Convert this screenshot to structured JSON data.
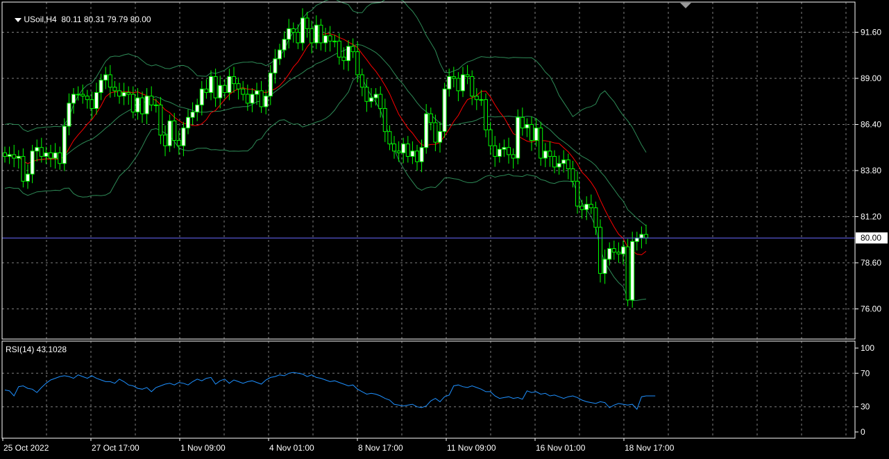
{
  "header": {
    "symbol": "USoil,H4",
    "ohlc": "80.11 80.31 79.79 80.00"
  },
  "rsi_panel": {
    "label": "RSI(14) 43.1028",
    "levels": [
      "100",
      "70",
      "30",
      "0"
    ]
  },
  "price_axis": {
    "ticks": [
      "91.60",
      "89.00",
      "86.40",
      "83.80",
      "81.20",
      "78.60",
      "76.00"
    ],
    "current_price": "80.00"
  },
  "time_axis": {
    "labels": [
      "25 Oct 2022",
      "27 Oct 17:00",
      "1 Nov 09:00",
      "4 Nov 01:00",
      "8 Nov 17:00",
      "11 Nov 09:00",
      "16 Nov 01:00",
      "18 Nov 17:00"
    ]
  },
  "colors": {
    "background": "#000000",
    "bull": "#ffffff",
    "bear": "#000000",
    "candle_outline": "#00ff00",
    "bands": "#2e8b57",
    "ma": "#ff0000",
    "rsi": "#1e90ff",
    "grid": "#808080",
    "price_line": "#6a6aff"
  },
  "chart_data": {
    "type": "candlestick",
    "title": "USoil,H4",
    "ylim": [
      74.3,
      93.3
    ],
    "current": 80.0,
    "closes": [
      84.6,
      84.7,
      84.5,
      84.6,
      83.2,
      83.6,
      84.9,
      85.1,
      84.6,
      84.8,
      84.5,
      84.8,
      84.2,
      86.3,
      87.6,
      88.1,
      88.1,
      88.0,
      87.8,
      87.3,
      88.2,
      88.9,
      89.2,
      88.5,
      88.3,
      88.0,
      88.2,
      88.1,
      87.1,
      87.9,
      87.0,
      88.0,
      87.5,
      87.5,
      85.8,
      85.2,
      86.6,
      85.5,
      85.2,
      86.2,
      86.8,
      87.1,
      87.5,
      88.4,
      88.2,
      89.1,
      87.9,
      88.6,
      88.2,
      89.1,
      88.7,
      88.4,
      88.1,
      87.6,
      88.1,
      88.3,
      87.4,
      88.0,
      89.3,
      90.1,
      90.6,
      91.2,
      91.8,
      91.6,
      91.0,
      92.4,
      91.8,
      91.0,
      92.0,
      91.0,
      91.4,
      91.1,
      91.1,
      90.2,
      90.0,
      90.8,
      90.5,
      89.2,
      88.5,
      87.7,
      87.9,
      88.1,
      87.3,
      86.0,
      85.3,
      84.9,
      84.8,
      85.3,
      84.6,
      84.9,
      84.3,
      85.1,
      87.0,
      86.5,
      85.4,
      86.0,
      88.4,
      89.1,
      89.0,
      88.3,
      89.2,
      89.1,
      88.0,
      87.8,
      87.8,
      86.1,
      85.2,
      84.6,
      85.0,
      85.1,
      84.7,
      84.5,
      86.8,
      86.2,
      86.4,
      85.5,
      86.2,
      84.5,
      84.9,
      84.6,
      84.0,
      84.2,
      84.4,
      83.9,
      83.2,
      81.8,
      81.6,
      81.9,
      81.7,
      80.6,
      78.0,
      78.8,
      79.4,
      79.2,
      79.1,
      79.5,
      76.5,
      79.8,
      80.0,
      80.2,
      80.0
    ],
    "rsi": [
      50,
      49,
      43,
      54,
      55,
      52,
      51,
      47,
      53,
      58,
      62,
      64,
      66,
      67,
      66,
      64,
      68,
      66,
      64,
      67,
      64,
      62,
      60,
      60,
      58,
      63,
      60,
      56,
      55,
      52,
      51,
      53,
      48,
      53,
      55,
      57,
      58,
      56,
      59,
      58,
      56,
      60,
      63,
      61,
      64,
      65,
      57,
      61,
      63,
      58,
      62,
      60,
      58,
      60,
      61,
      59,
      57,
      62,
      65,
      66,
      68,
      67,
      70,
      71,
      70,
      69,
      66,
      68,
      65,
      64,
      62,
      60,
      61,
      59,
      57,
      55,
      56,
      51,
      48,
      45,
      46,
      45,
      43,
      40,
      38,
      33,
      32,
      31,
      32,
      33,
      30,
      29,
      31,
      37,
      40,
      36,
      42,
      44,
      55,
      56,
      54,
      53,
      55,
      53,
      51,
      48,
      48,
      43,
      40,
      41,
      42,
      40,
      41,
      39,
      49,
      47,
      48,
      45,
      46,
      43,
      44,
      42,
      40,
      42,
      43,
      41,
      38,
      36,
      35,
      34,
      36,
      35,
      29,
      32,
      34,
      33,
      32,
      33,
      27,
      42,
      43,
      43,
      43
    ]
  }
}
